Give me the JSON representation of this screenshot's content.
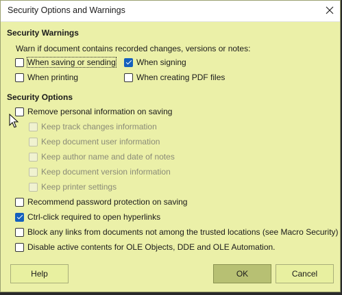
{
  "window": {
    "title": "Security Options and Warnings"
  },
  "warnings": {
    "heading": "Security Warnings",
    "description": "Warn if document contains recorded changes, versions or notes:",
    "items": [
      {
        "label": "When saving or sending",
        "checked": false
      },
      {
        "label": "When signing",
        "checked": true
      },
      {
        "label": "When printing",
        "checked": false
      },
      {
        "label": "When creating PDF files",
        "checked": false
      }
    ]
  },
  "options": {
    "heading": "Security Options",
    "remove_personal": {
      "label": "Remove personal information on saving",
      "checked": false
    },
    "sub_items": [
      {
        "label": "Keep track changes information",
        "checked": false
      },
      {
        "label": "Keep document user information",
        "checked": false
      },
      {
        "label": "Keep author name and date of notes",
        "checked": false
      },
      {
        "label": "Keep document version information",
        "checked": false
      },
      {
        "label": "Keep printer settings",
        "checked": false
      }
    ],
    "items": [
      {
        "label": "Recommend password protection on saving",
        "checked": false
      },
      {
        "label": "Ctrl-click required to open hyperlinks",
        "checked": true
      },
      {
        "label": "Block any links from documents not among the trusted locations (see Macro Security)",
        "checked": false
      },
      {
        "label": "Disable active contents for OLE Objects, DDE and OLE Automation.",
        "checked": false
      }
    ]
  },
  "buttons": {
    "help": "Help",
    "ok": "OK",
    "cancel": "Cancel"
  },
  "icons": {
    "close": "close-icon",
    "cursor": "mouse-pointer-icon"
  },
  "colors": {
    "dialog_bg": "#ebf0a8",
    "checked_accent": "#1560bd",
    "default_button": "#b7c073"
  }
}
